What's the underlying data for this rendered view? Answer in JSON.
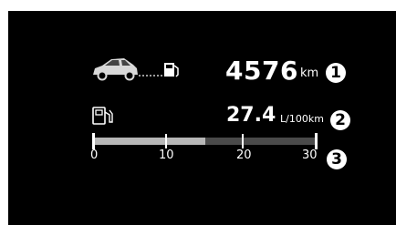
{
  "range": {
    "value": "4576",
    "unit": "km",
    "callout": "1"
  },
  "consumption": {
    "value": "27.4",
    "unit": "L/100km",
    "callout": "2"
  },
  "scale": {
    "ticks": [
      "0",
      "10",
      "20",
      "30"
    ],
    "fill_fraction": 0.5,
    "max": 30,
    "callout": "3"
  },
  "icons": {
    "car": "car-to-pump-icon",
    "pump": "fuel-pump-icon"
  },
  "colors": {
    "background": "#000000",
    "bar_fill": "#b7b7b7",
    "bar_track": "#4a4a4a"
  }
}
